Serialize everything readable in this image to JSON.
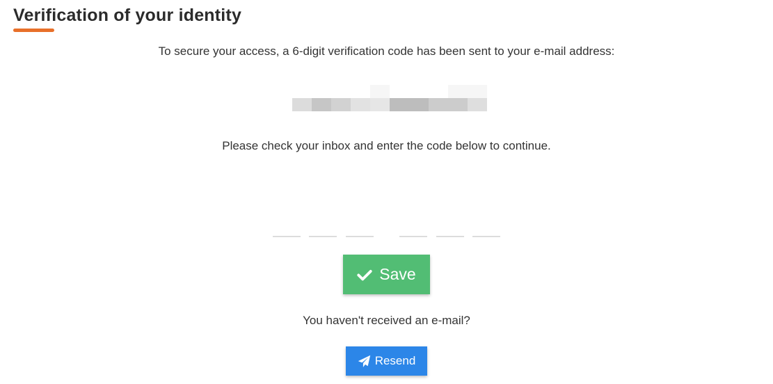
{
  "header": {
    "title": "Verification of your identity",
    "accent_color": "#e8702a"
  },
  "intro": {
    "text": "To secure your access, a 6-digit verification code has been sent to your e-mail address:"
  },
  "email": {
    "masked": true
  },
  "instruction": {
    "text": "Please check your inbox and enter the code below to continue."
  },
  "code": {
    "digits": [
      "",
      "",
      "",
      "",
      "",
      ""
    ]
  },
  "save_button": {
    "label": "Save",
    "icon": "check-icon",
    "color": "#52bd74"
  },
  "resend_section": {
    "prompt": "You haven't received an e-mail?",
    "button_label": "Resend",
    "button_icon": "paper-plane-icon",
    "button_color": "#2c86e8"
  }
}
